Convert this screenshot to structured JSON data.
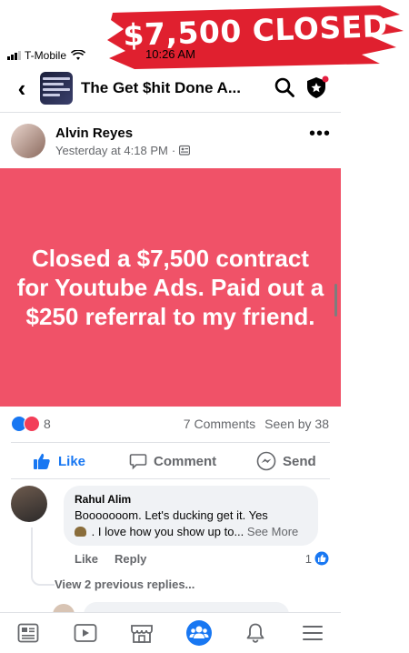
{
  "banner": {
    "text": "$7,500 CLOSED"
  },
  "status_bar": {
    "carrier": "T-Mobile",
    "time": "10:26 AM"
  },
  "header": {
    "group_name": "The Get $hit Done A...",
    "icons": [
      "back-arrow-icon",
      "search-icon",
      "admin-shield-icon"
    ]
  },
  "post": {
    "author": "Alvin Reyes",
    "timestamp": "Yesterday at 4:18 PM",
    "separator": "·",
    "body": "Closed a $7,500 contract for Youtube Ads. Paid out a $250 referral to my friend.",
    "background_color": "#f05268",
    "reactions_count": "8",
    "comments_count": "7 Comments",
    "seen_by": "Seen by 38"
  },
  "actions": {
    "like": "Like",
    "comment": "Comment",
    "send": "Send"
  },
  "comment": {
    "author": "Rahul Alim",
    "text_line1": "Booooooom. Let's ducking get it.  Yes",
    "text_line2": ". I love how you show up to...",
    "see_more": "See More",
    "like": "Like",
    "reply": "Reply",
    "reaction_count": "1",
    "view_replies": "View 2 previous replies..."
  },
  "tabbar": {
    "items": [
      "feed-icon",
      "watch-icon",
      "marketplace-icon",
      "groups-icon",
      "notifications-icon",
      "menu-icon"
    ],
    "active": "groups-icon"
  },
  "colors": {
    "accent": "#1877f2",
    "banner_red": "#e0202f",
    "secondary_text": "#65676b"
  }
}
